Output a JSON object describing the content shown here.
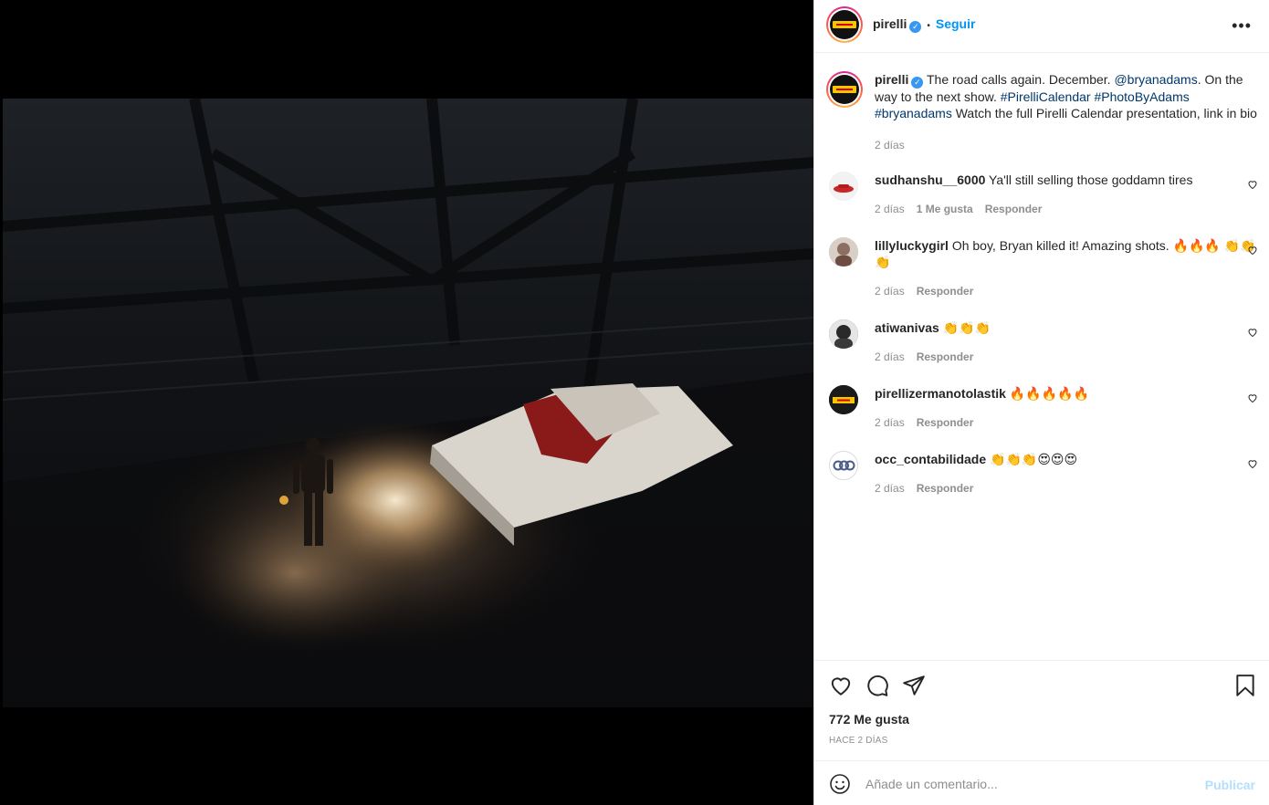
{
  "post": {
    "author": "pirelli",
    "verified_badge": "✓",
    "separator": "•",
    "follow_label": "Seguir",
    "more_label": "•••"
  },
  "caption": {
    "author": "pirelli",
    "text_part1": "The road calls again. December. ",
    "mention": "@bryanadams",
    "text_part2": ". On the way to the next show. ",
    "hashtag1": "#PirelliCalendar",
    "hashtag2": "#PhotoByAdams",
    "hashtag3": "#bryanadams",
    "text_part3": " Watch the full Pirelli Calendar presentation, link in bio",
    "time": "2 días"
  },
  "comments": [
    {
      "user": "sudhanshu__6000",
      "text": "Ya'll still selling those goddamn tires",
      "time": "2 días",
      "likes": "1 Me gusta",
      "reply": "Responder"
    },
    {
      "user": "lillyluckygirl",
      "text": "Oh boy, Bryan killed it! Amazing shots. 🔥🔥🔥 👏👏👏",
      "time": "2 días",
      "reply": "Responder"
    },
    {
      "user": "atiwanivas",
      "text": "👏👏👏",
      "time": "2 días",
      "reply": "Responder"
    },
    {
      "user": "pirellizermanotolastik",
      "text": "🔥🔥🔥🔥🔥",
      "time": "2 días",
      "reply": "Responder"
    },
    {
      "user": "occ_contabilidade",
      "text": "👏👏👏😍😍😍",
      "time": "2 días",
      "reply": "Responder"
    }
  ],
  "engagement": {
    "likes": "772 Me gusta",
    "posted_ago": "HACE 2 DÍAS"
  },
  "composer": {
    "placeholder": "Añade un comentario...",
    "publish_label": "Publicar"
  },
  "icons": {
    "like": "heart-icon",
    "comment": "comment-bubble-icon",
    "share": "paper-plane-icon",
    "save": "bookmark-icon",
    "emoji": "smiley-icon"
  },
  "colors": {
    "link": "#00376b",
    "follow": "#0095f6",
    "publish_disabled": "#b2dffc",
    "muted": "#8e8e8e"
  }
}
